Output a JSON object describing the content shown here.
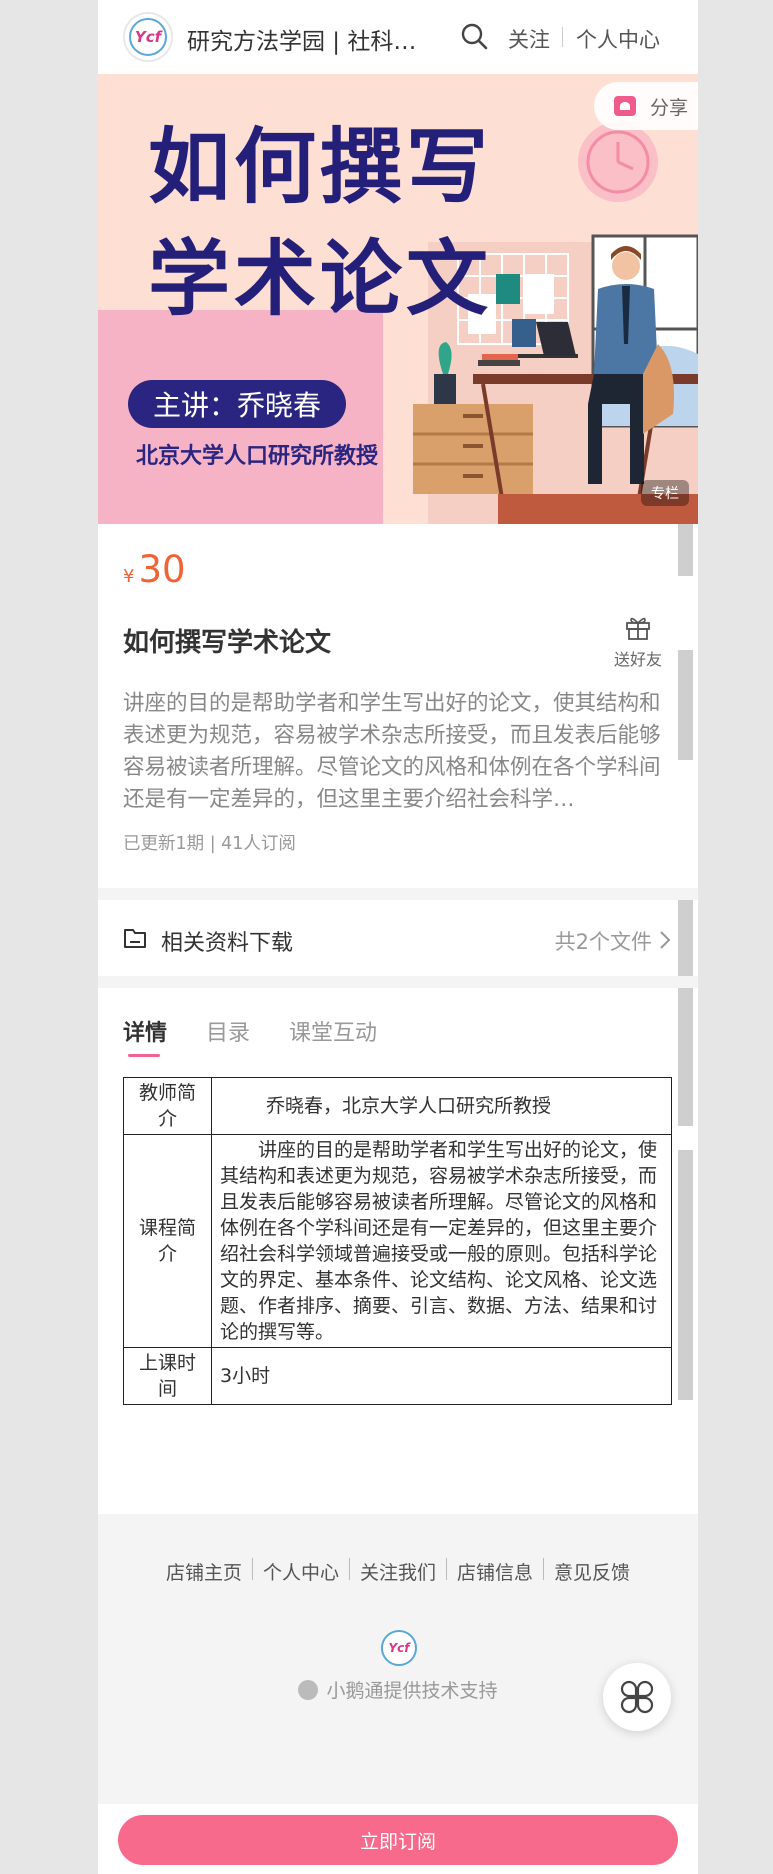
{
  "header": {
    "shop_name": "研究方法学园 | 社科…",
    "follow_label": "关注",
    "personal_center_label": "个人中心",
    "logo_text": "Ycf"
  },
  "banner": {
    "title_line1": "如何撰写",
    "title_line2": "学术论文",
    "lecturer": "主讲：乔晓春",
    "lecturer_org": "北京大学人口研究所教授",
    "column_tag": "专栏",
    "share_label": "分享"
  },
  "course": {
    "price_symbol": "¥",
    "price": "30",
    "title": "如何撰写学术论文",
    "gift_label": "送好友",
    "description": "讲座的目的是帮助学者和学生写出好的论文，使其结构和表述更为规范，容易被学术杂志所接受，而且发表后能够容易被读者所理解。尽管论文的风格和体例在各个学科间还是有一定差异的，但这里主要介绍社会科学…",
    "meta": "已更新1期 | 41人订阅"
  },
  "download": {
    "title": "相关资料下载",
    "count": "共2个文件"
  },
  "tabs": [
    {
      "label": "详情"
    },
    {
      "label": "目录"
    },
    {
      "label": "课堂互动"
    }
  ],
  "details_table": {
    "teacher_label": "教师简介",
    "teacher_value": "乔晓春，北京大学人口研究所教授",
    "course_label": "课程简介",
    "course_value": "讲座的目的是帮助学者和学生写出好的论文，使其结构和表述更为规范，容易被学术杂志所接受，而且发表后能够容易被读者所理解。尽管论文的风格和体例在各个学科间还是有一定差异的，但这里主要介绍社会科学领域普遍接受或一般的原则。包括科学论文的界定、基本条件、论文结构、论文风格、论文选题、作者排序、摘要、引言、数据、方法、结果和讨论的撰写等。",
    "time_label": "上课时间",
    "time_value": "3小时"
  },
  "footer": {
    "links": [
      "店铺主页",
      "个人中心",
      "关注我们",
      "店铺信息",
      "意见反馈"
    ],
    "support": "小鹅通提供技术支持",
    "logo_text": "Ycf"
  },
  "bottom": {
    "subscribe_label": "立即订阅"
  },
  "colors": {
    "accent_pink": "#f76a8c",
    "price_orange": "#ef6335",
    "banner_navy": "#24207a"
  }
}
